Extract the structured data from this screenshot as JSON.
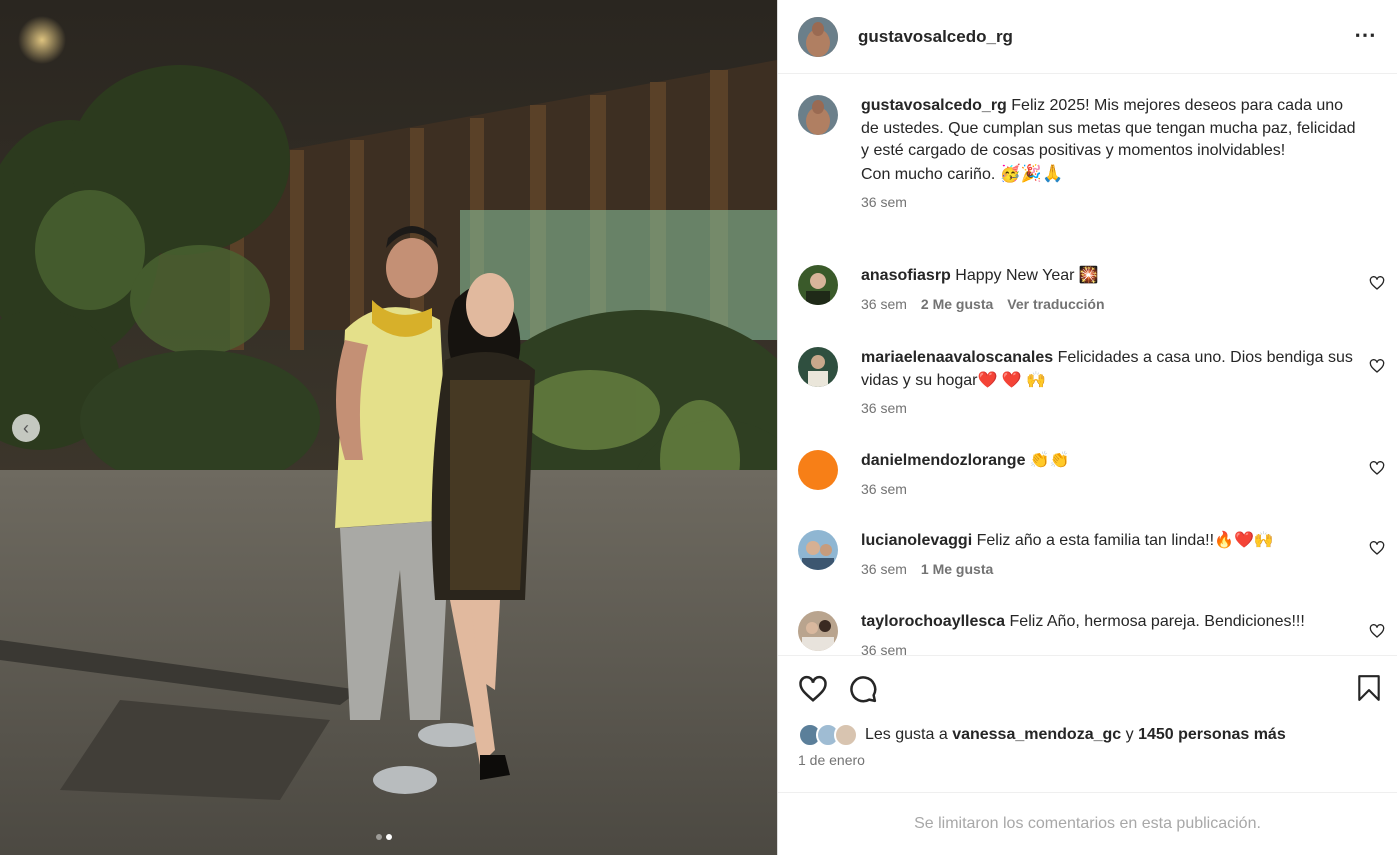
{
  "post": {
    "author": "gustavosalcedo_rg",
    "more_icon": "⋯",
    "caption": {
      "username": "gustavosalcedo_rg",
      "text": "Feliz 2025! Mis mejores deseos para cada uno de ustedes. Que cumplan sus metas que tengan mucha paz, felicidad y esté cargado de cosas positivas y momentos inolvidables!",
      "closing": "Con mucho cariño.",
      "emojis": "🥳🎉🙏",
      "time": "36 sem"
    }
  },
  "carousel": {
    "total": 2,
    "active_index": 1,
    "prev_icon": "chevron-left-icon"
  },
  "comments": [
    {
      "username": "anasofiasrp",
      "text": "Happy New Year 🎇",
      "time": "36 sem",
      "likes": "2 Me gusta",
      "translate": "Ver traducción",
      "avatar_color": "#3a5a2a"
    },
    {
      "username": "mariaelenaavaloscanales",
      "text": "Felicidades a casa uno. Dios bendiga sus vidas y su hogar❤️ ❤️ 🙌",
      "time": "36 sem",
      "likes": "",
      "translate": "",
      "avatar_color": "#2f4f3f"
    },
    {
      "username": "danielmendozlorange",
      "text": "👏👏",
      "time": "36 sem",
      "likes": "",
      "translate": "",
      "avatar_color": "#f77f17"
    },
    {
      "username": "lucianolevaggi",
      "text": "Feliz año a esta familia tan linda!!🔥❤️🙌",
      "time": "36 sem",
      "likes": "1 Me gusta",
      "translate": "",
      "avatar_color": "#6a8fb0"
    },
    {
      "username": "taylorochoayllesca",
      "text": "Feliz Año, hermosa pareja. Bendiciones!!!",
      "time": "36 sem",
      "likes": "",
      "translate": "",
      "avatar_color": "#b9a48e"
    }
  ],
  "likes": {
    "prefix": "Les gusta a",
    "user": "vanessa_mendoza_gc",
    "connector": "y",
    "others": "1450 personas más"
  },
  "date": "1 de enero",
  "comments_limited": "Se limitaron los comentarios en esta publicación.",
  "colors": {
    "text": "#262626",
    "secondary": "#737373",
    "muted": "#a8a8a8",
    "border": "#dbdbdb"
  }
}
